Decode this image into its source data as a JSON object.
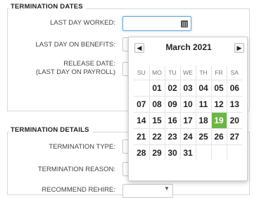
{
  "termination_dates": {
    "section_title": "TERMINATION DATES",
    "last_day_worked_label": "LAST DAY WORKED:",
    "last_day_on_benefits_label": "LAST DAY ON BENEFITS:",
    "release_date_label_line1": "RELEASE DATE:",
    "release_date_label_line2": "(LAST DAY ON PAYROLL)"
  },
  "termination_details": {
    "section_title": "TERMINATION DETAILS",
    "termination_type_label": "TERMINATION TYPE:",
    "termination_reason_label": "TERMINATION REASON:",
    "recommend_rehire_label": "RECOMMEND REHIRE:"
  },
  "datepicker": {
    "month_title": "March 2021",
    "prev_icon": "chevron-left-icon",
    "next_icon": "chevron-right-icon",
    "weekdays": [
      "SU",
      "MO",
      "TU",
      "WE",
      "TH",
      "FR",
      "SA"
    ],
    "weeks": [
      [
        "",
        "01",
        "02",
        "03",
        "04",
        "05",
        "06"
      ],
      [
        "07",
        "08",
        "09",
        "10",
        "11",
        "12",
        "13"
      ],
      [
        "14",
        "15",
        "16",
        "17",
        "18",
        "19",
        "20"
      ],
      [
        "21",
        "22",
        "23",
        "24",
        "25",
        "26",
        "27"
      ],
      [
        "28",
        "29",
        "30",
        "31",
        "",
        "",
        ""
      ]
    ],
    "selected_day": "19",
    "selected_color": "#6bb744"
  }
}
